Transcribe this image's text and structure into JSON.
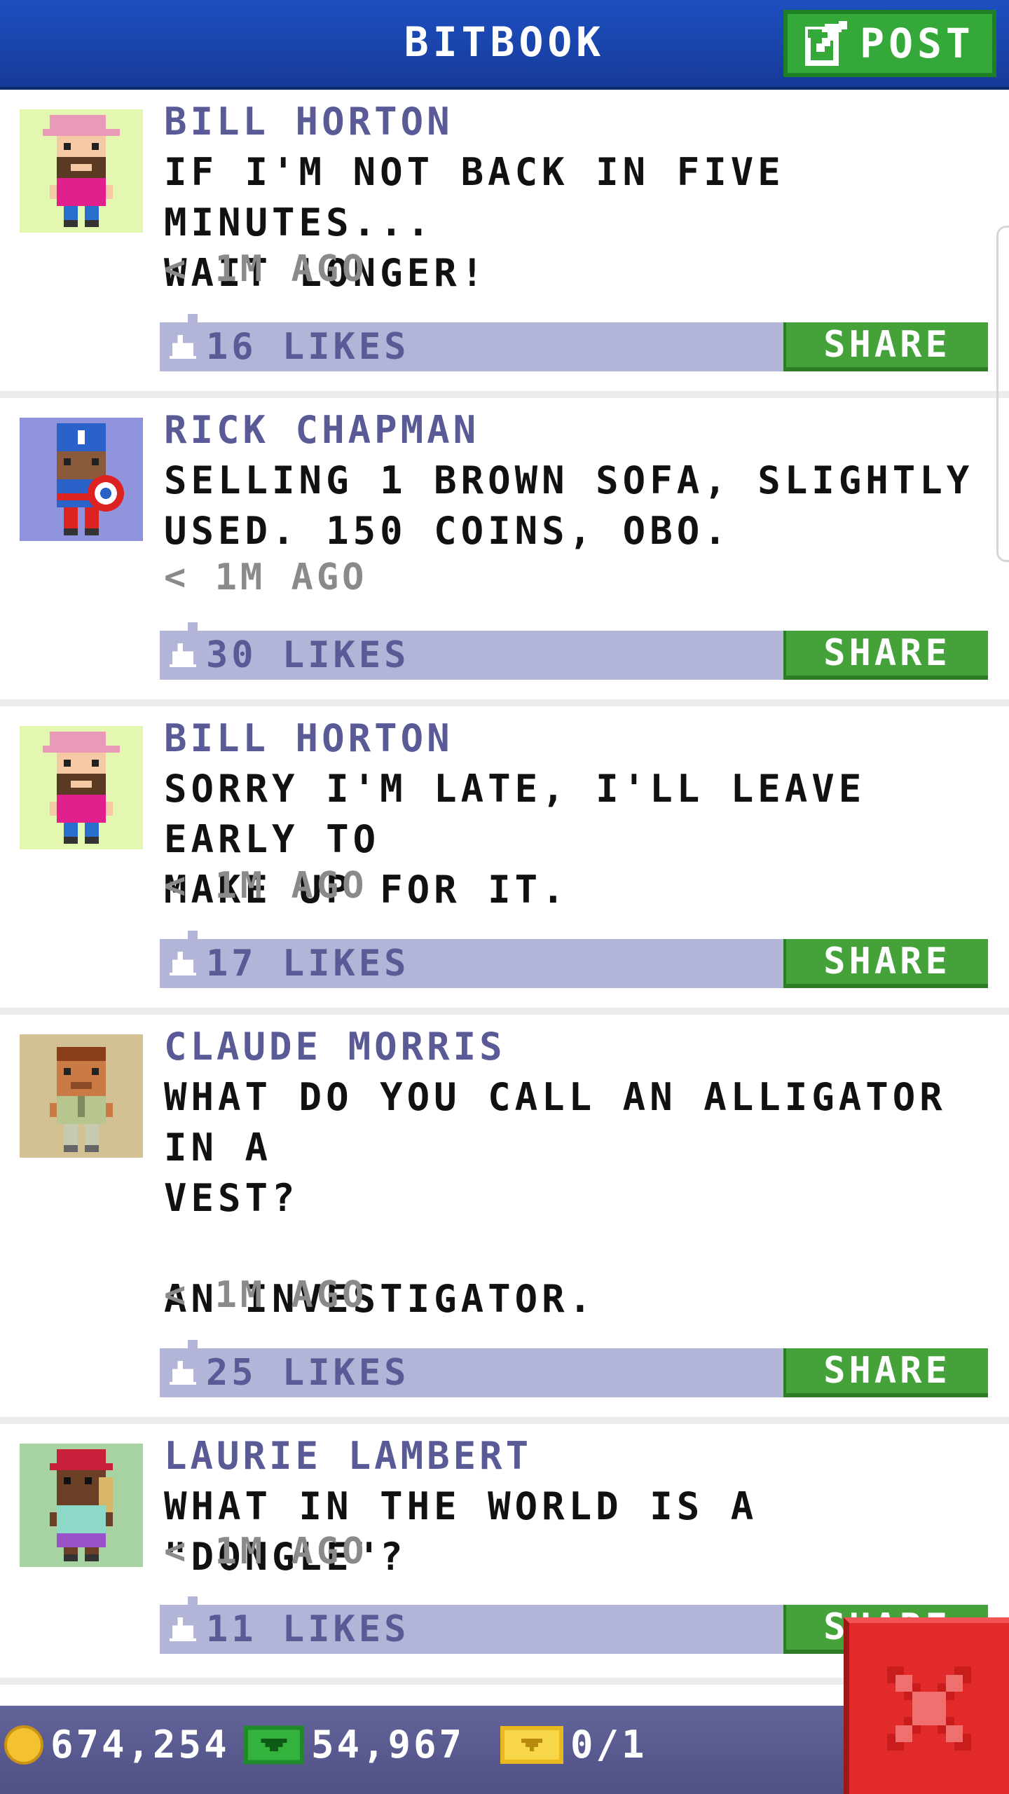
{
  "header": {
    "title": "BITBOOK",
    "post_label": "POST"
  },
  "colors": {
    "header": "#1d4fc1",
    "post_button": "#35a83a",
    "share_button": "#45a23a",
    "likes_bar": "#b3b5d8",
    "author_text": "#5a5a96",
    "close_button": "#e22a2a"
  },
  "posts": [
    {
      "author": "BILL HORTON",
      "message": "IF I'M NOT BACK IN FIVE MINUTES...\nWAIT LONGER!",
      "time": "< 1M AGO",
      "likes": "16 LIKES",
      "share_label": "SHARE",
      "avatar_icon": "bill-horton-avatar-icon"
    },
    {
      "author": "RICK CHAPMAN",
      "message": "SELLING 1 BROWN SOFA, SLIGHTLY\nUSED. 150 COINS, OBO.",
      "time": "< 1M AGO",
      "likes": "30 LIKES",
      "share_label": "SHARE",
      "avatar_icon": "rick-chapman-avatar-icon"
    },
    {
      "author": "BILL HORTON",
      "message": "SORRY I'M LATE, I'LL LEAVE EARLY TO\nMAKE UP FOR IT.",
      "time": "< 1M AGO",
      "likes": "17 LIKES",
      "share_label": "SHARE",
      "avatar_icon": "bill-horton-avatar-icon"
    },
    {
      "author": "CLAUDE MORRIS",
      "message": "WHAT DO YOU CALL AN ALLIGATOR IN A\nVEST?\n\nAN INVESTIGATOR.",
      "time": "< 1M AGO",
      "likes": "25 LIKES",
      "share_label": "SHARE",
      "avatar_icon": "claude-morris-avatar-icon"
    },
    {
      "author": "LAURIE LAMBERT",
      "message": "WHAT IN THE WORLD IS A \"DONGLE\"?",
      "time": "< 1M AGO",
      "likes": "11 LIKES",
      "share_label": "SHARE",
      "avatar_icon": "laurie-lambert-avatar-icon"
    }
  ],
  "bottom_bar": {
    "coins": "674,254",
    "bux": "54,967",
    "tickets": "0/1"
  }
}
